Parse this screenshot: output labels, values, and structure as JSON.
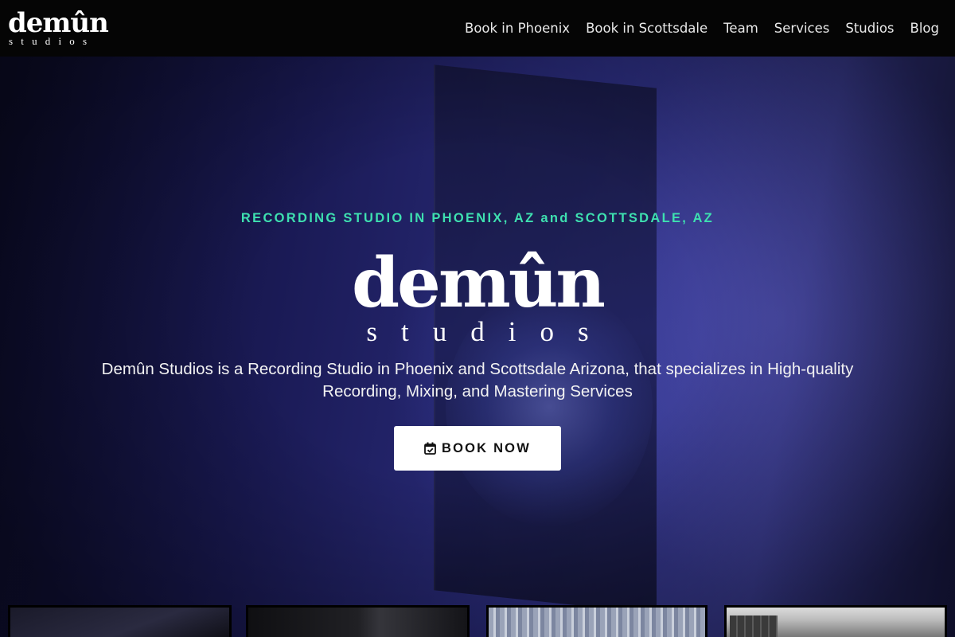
{
  "header": {
    "logo": {
      "word": "demûn",
      "sub": "studios"
    },
    "nav": [
      {
        "label": "Book in Phoenix"
      },
      {
        "label": "Book in Scottsdale"
      },
      {
        "label": "Team"
      },
      {
        "label": "Services"
      },
      {
        "label": "Studios"
      },
      {
        "label": "Blog"
      }
    ]
  },
  "hero": {
    "eyebrow": "RECORDING STUDIO IN PHOENIX, AZ and SCOTTSDALE, AZ",
    "logo": {
      "word": "demûn",
      "sub": "studios"
    },
    "tagline": "Demûn Studios is a Recording Studio in Phoenix and Scottsdale Arizona, that specializes in High-quality Recording, Mixing, and Mastering Services",
    "cta": {
      "label": "BOOK NOW",
      "icon": "calendar-check-icon"
    }
  },
  "colors": {
    "eyebrow": "#3ee0b0",
    "header_bg": "#050505",
    "button_bg": "#ffffff",
    "button_text": "#111111"
  }
}
